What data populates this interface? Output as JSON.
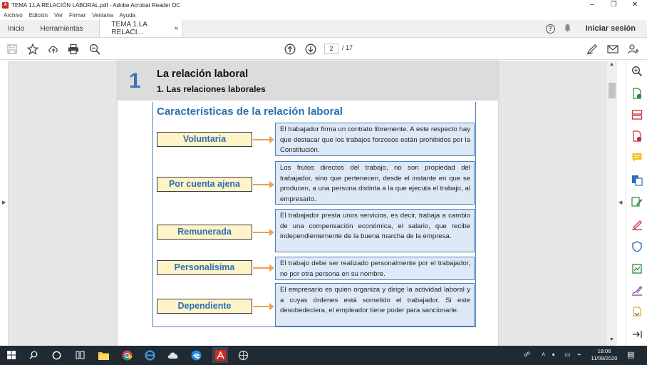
{
  "window": {
    "title": "TEMA 1.LA RELACIÓN LABORAL.pdf - Adobe Acrobat Reader DC",
    "minimize": "–",
    "maximize": "❐",
    "close": "✕"
  },
  "menu": [
    "Archivo",
    "Edición",
    "Ver",
    "Firmar",
    "Ventana",
    "Ayuda"
  ],
  "tabs": {
    "home": "Inicio",
    "tools": "Herramientas",
    "document": "TEMA 1.LA RELACI...",
    "close": "×",
    "help": "?",
    "signin": "Iniciar sesión"
  },
  "toolbar": {
    "current_page": "2",
    "total_pages": "/ 17"
  },
  "page": {
    "chapter_number": "1",
    "chapter_title": "La relación laboral",
    "chapter_subtitle": "1. Las relaciones laborales",
    "section_title": "Características de la relación laboral",
    "characteristics": [
      {
        "label": "Voluntaria",
        "description": "El trabajador firma un contrato libremente. A este respecto hay que destacar que los trabajos forzosos están prohibidos por la Constitución."
      },
      {
        "label": "Por cuenta ajena",
        "description": "Los frutos directos del trabajo, no son propiedad del trabajador, sino que pertenecen, desde el instante en que se producen, a una persona distinta a la que ejecuta el trabajo, al empresario."
      },
      {
        "label": "Remunerada",
        "description": "El trabajador presta unos servicios, es decir, trabaja a cambio de una compensación económica, el salario, que recibe independientemente de la buena marcha de la empresa."
      },
      {
        "label": "Personalísima",
        "description": "El trabajo debe ser realizado personalmente por el trabajador, no por otra persona en su nombre."
      },
      {
        "label": "Dependiente",
        "description": "El empresario es quien organiza y dirige la actividad laboral y a cuyas órdenes está sometido el trabajador. Si este desobedeciera, el empleador tiene poder para sancionarle."
      }
    ]
  },
  "taskbar": {
    "time": "18:06",
    "date": "11/09/2020"
  },
  "colors": {
    "accent_blue": "#2a6fb4",
    "label_fill": "#fff3c8",
    "desc_fill": "#dde9f6",
    "arrow": "#f0a050",
    "taskbar": "#1f2a33"
  }
}
